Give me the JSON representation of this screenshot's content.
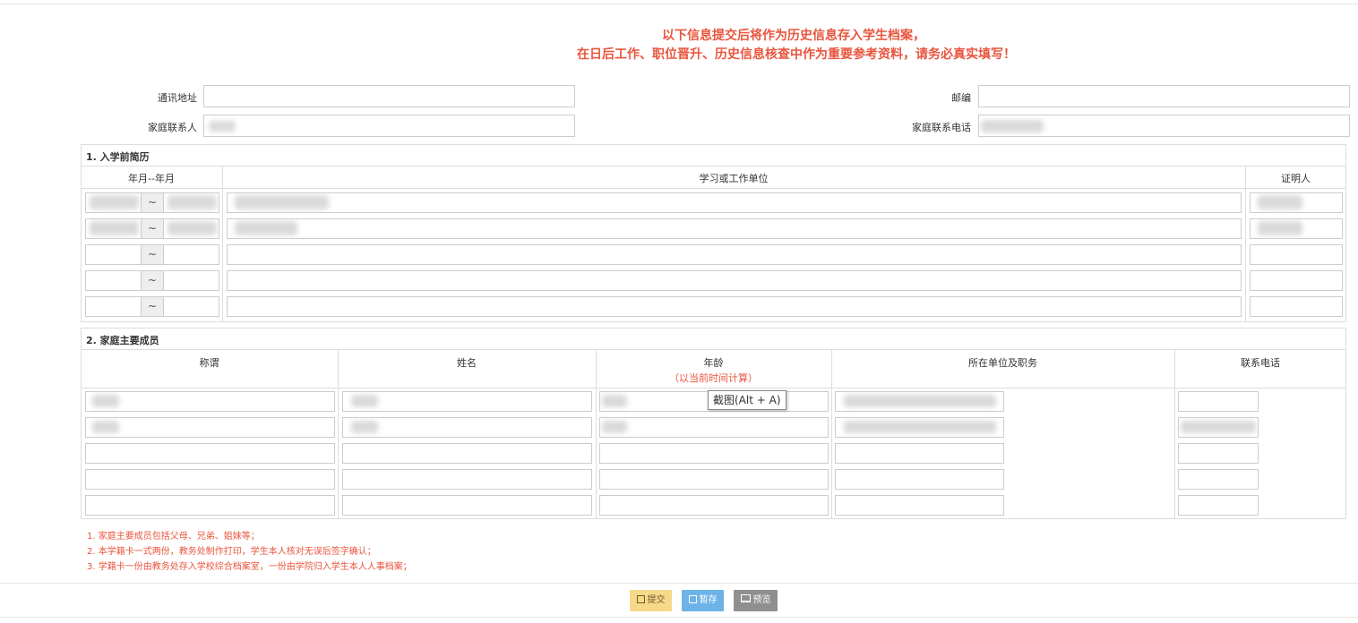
{
  "notice": {
    "line1": "以下信息提交后将作为历史信息存入学生档案，",
    "line2": "在日后工作、职位晋升、历史信息核查中作为重要参考资料，请务必真实填写！"
  },
  "contact": {
    "address_label": "通讯地址",
    "postcode_label": "邮编",
    "family_contact_label": "家庭联系人",
    "family_phone_label": "家庭联系电话"
  },
  "resume": {
    "title": "1. 入学前简历",
    "columns": [
      "年月--年月",
      "学习或工作单位",
      "证明人"
    ],
    "separator": "~"
  },
  "family": {
    "title": "2. 家庭主要成员",
    "columns": [
      "称谓",
      "姓名",
      "年龄",
      "所在单位及职务",
      "联系电话"
    ],
    "age_note": "（以当前时间计算）"
  },
  "notes": [
    "1. 家庭主要成员包括父母、兄弟、姐妹等；",
    "2. 本学籍卡一式两份，教务处制作打印，学生本人核对无误后签字确认；",
    "3. 学籍卡一份由教务处存入学校综合档案室，一份由学院归入学生本人人事档案；"
  ],
  "buttons": {
    "submit": "提交",
    "save": "暂存",
    "preview": "预览"
  },
  "tooltip": "截图(Alt + A)",
  "icons": {
    "submit": "floppy-icon",
    "save": "floppy-icon",
    "preview": "monitor-icon"
  }
}
